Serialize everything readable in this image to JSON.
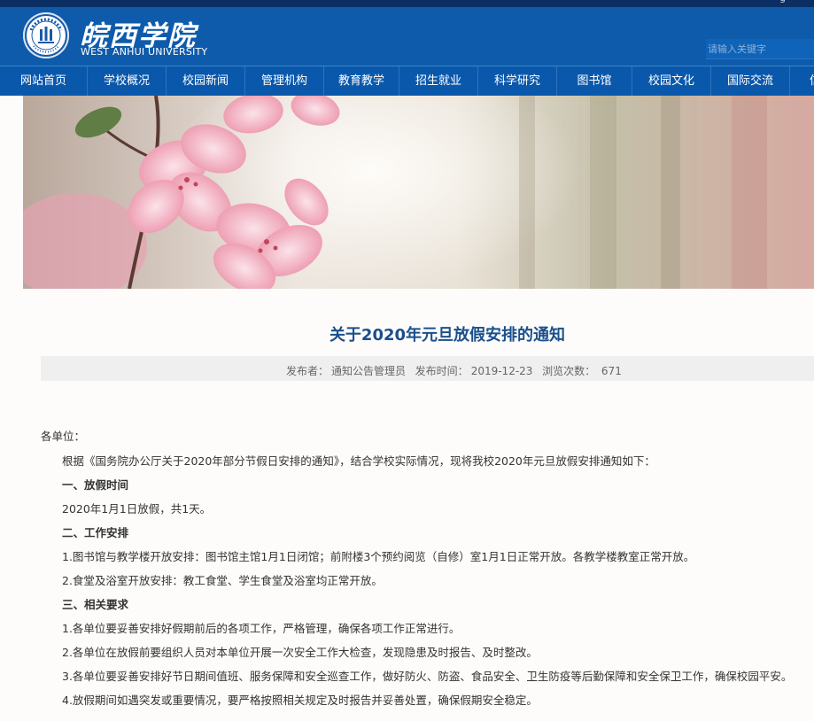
{
  "header": {
    "top_text": "g",
    "logo_cn": "皖西学院",
    "logo_en": "WEST ANHUI UNIVERSITY",
    "search_placeholder": "请输入关键字"
  },
  "nav": {
    "items": [
      "网站首页",
      "学校概况",
      "校园新闻",
      "管理机构",
      "教育教学",
      "招生就业",
      "科学研究",
      "图书馆",
      "校园文化",
      "国际交流",
      "信息"
    ]
  },
  "article": {
    "title": "关于2020年元旦放假安排的通知",
    "publisher_label": "发布者：",
    "publisher": "通知公告管理员",
    "date_label": "发布时间：",
    "date": "2019-12-23",
    "views_label": "浏览次数：",
    "views": "671",
    "salutation": "各单位：",
    "intro": "根据《国务院办公厅关于2020年部分节假日安排的通知》，结合学校实际情况，现将我校2020年元旦放假安排通知如下：",
    "s1_title": "一、放假时间",
    "s1_text": "2020年1月1日放假，共1天。",
    "s2_title": "二、工作安排",
    "s2_p1": "1.图书馆与教学楼开放安排：图书馆主馆1月1日闭馆；前附楼3个预约阅览（自修）室1月1日正常开放。各教学楼教室正常开放。",
    "s2_p2": "2.食堂及浴室开放安排：教工食堂、学生食堂及浴室均正常开放。",
    "s3_title": "三、相关要求",
    "s3_p1": "1.各单位要妥善安排好假期前后的各项工作，严格管理，确保各项工作正常进行。",
    "s3_p2": "2.各单位在放假前要组织人员对本单位开展一次安全工作大检查，发现隐患及时报告、及时整改。",
    "s3_p3": "3.各单位要妥善安排好节日期间值班、服务保障和安全巡查工作，做好防火、防盗、食品安全、卫生防疫等后勤保障和安全保卫工作，确保校园平安。",
    "s3_p4": "4.放假期间如遇突发或重要情况，要严格按照相关规定及时报告并妥善处置，确保假期安全稳定。"
  }
}
